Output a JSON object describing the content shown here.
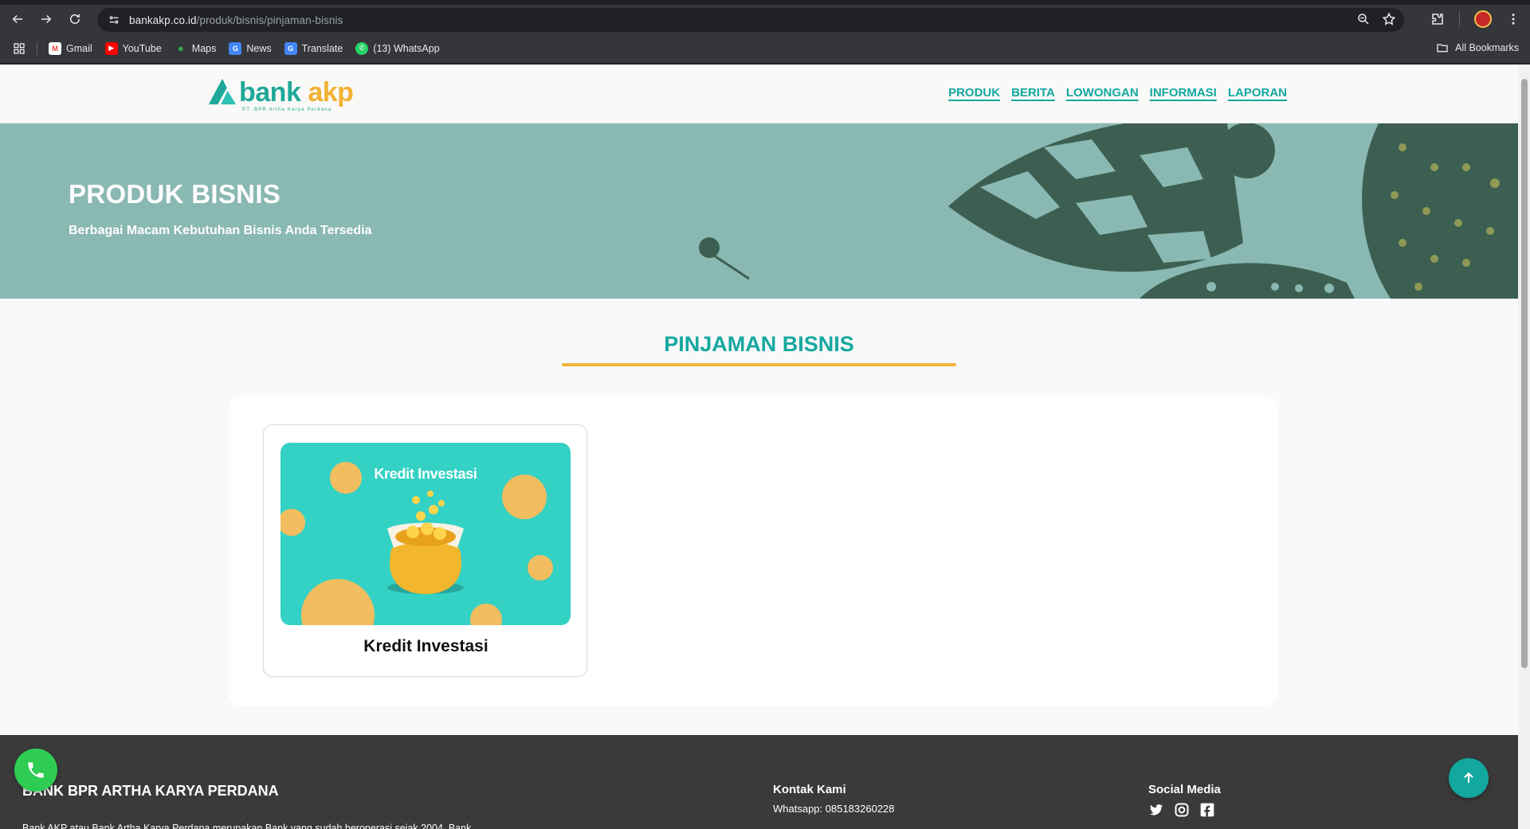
{
  "browser": {
    "url_host": "bankakp.co.id",
    "url_path": "/produk/bisnis/pinjaman-bisnis",
    "bookmarks": [
      {
        "label": "Gmail",
        "icon": "gmail-icon",
        "color": "#ea4335"
      },
      {
        "label": "YouTube",
        "icon": "youtube-icon",
        "color": "#ff0000"
      },
      {
        "label": "Maps",
        "icon": "maps-icon",
        "color": "#34a853"
      },
      {
        "label": "News",
        "icon": "news-icon",
        "color": "#4285f4"
      },
      {
        "label": "Translate",
        "icon": "translate-icon",
        "color": "#4285f4"
      },
      {
        "label": "(13) WhatsApp",
        "icon": "whatsapp-icon",
        "color": "#25d366"
      }
    ],
    "all_bookmarks": "All Bookmarks"
  },
  "site": {
    "logo": {
      "word_bank": "bank",
      "word_akp": "akp",
      "tagline": "PT. BPR Artha Karya Perdana"
    },
    "menu": [
      "PRODUK",
      "BERITA",
      "LOWONGAN",
      "INFORMASI",
      "LAPORAN"
    ],
    "hero": {
      "title": "PRODUK BISNIS",
      "subtitle": "Berbagai Macam Kebutuhan Bisnis Anda Tersedia"
    },
    "section_title": "PINJAMAN BISNIS",
    "products": [
      {
        "image_title": "Kredit Investasi",
        "label": "Kredit Investasi"
      }
    ],
    "footer": {
      "bank_name": "BANK BPR ARTHA KARYA PERDANA",
      "description": "Bank AKP atau Bank Artha Karya Perdana merupakan Bank yang sudah beroperasi sejak 2004. Bank",
      "contact_heading": "Kontak Kami",
      "contact_whatsapp": "Whatsapp: 085183260228",
      "social_heading": "Social Media"
    }
  },
  "colors": {
    "brand_teal": "#12a8a0",
    "brand_orange": "#f2b234",
    "hero_bg": "#8ab8b2",
    "footer_bg": "#3a3a3a"
  }
}
